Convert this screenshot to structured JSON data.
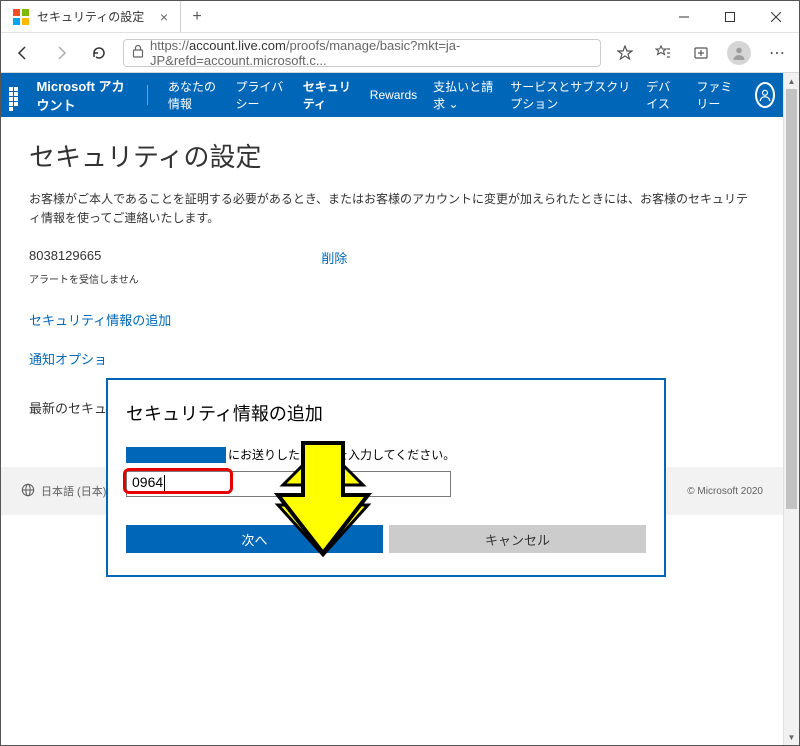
{
  "window": {
    "tab_title": "セキュリティの設定"
  },
  "addressbar": {
    "url_prefix": "https://",
    "url_host": "account.live.com",
    "url_path": "/proofs/manage/basic?mkt=ja-JP&refd=account.microsoft.c..."
  },
  "msnav": {
    "brand": "Microsoft アカウント",
    "items": [
      "あなたの情報",
      "プライバシー",
      "セキュリティ",
      "Rewards",
      "支払いと請求 ⌄",
      "サービスとサブスクリプション",
      "デバイス",
      "ファミリー"
    ],
    "selected_index": 2
  },
  "page": {
    "title": "セキュリティの設定",
    "description": "お客様がご本人であることを証明する必要があるとき、またはお客様のアカウントに変更が加えられたときには、お客様のセキュリティ情報を使ってご連絡いたします。",
    "phone": "8038129665",
    "delete_label": "削除",
    "alerts_off": "アラートを受信しません",
    "add_link": "セキュリティ情報の追加",
    "notif_link": "通知オプショ",
    "latest": "最新のセキュ"
  },
  "footer": {
    "locale": "日本語 (日本)",
    "copyright": "© Microsoft 2020"
  },
  "modal": {
    "title": "セキュリティ情報の追加",
    "instruction_suffix": "にお送りしたコードを入力してください。",
    "code_value": "0964",
    "next_label": "次へ",
    "cancel_label": "キャンセル"
  }
}
